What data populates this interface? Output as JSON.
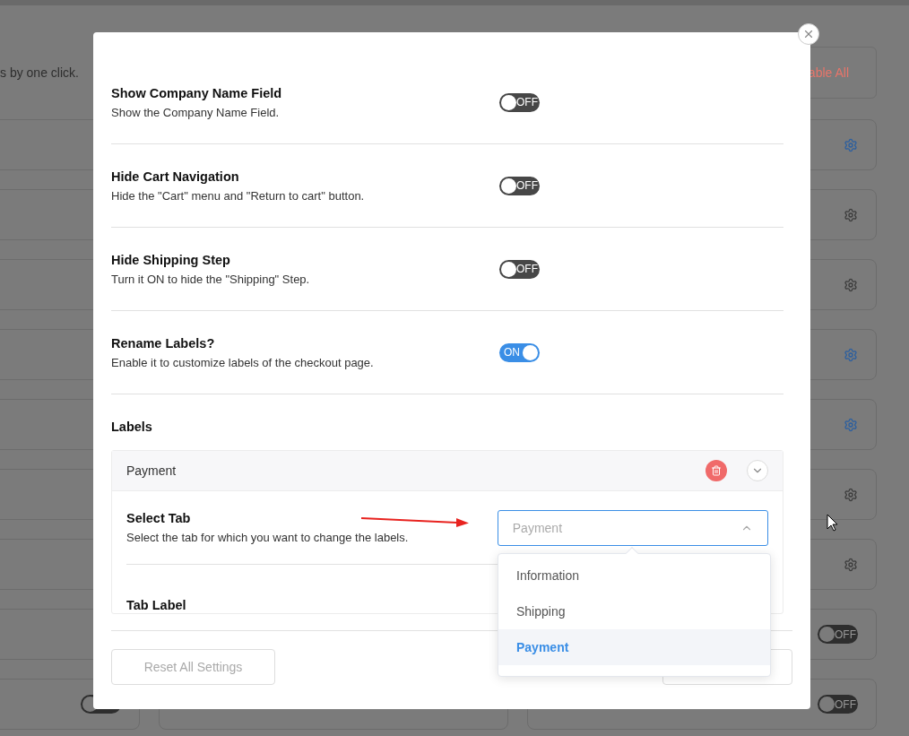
{
  "background": {
    "subtitle": "s by one click.",
    "disable_button": "able All",
    "left_cards": [
      {
        "kind": "plain"
      },
      {
        "kind": "plain"
      },
      {
        "kind": "plain"
      },
      {
        "kind": "plain"
      },
      {
        "kind": "plain"
      },
      {
        "kind": "plain"
      },
      {
        "kind": "plain"
      },
      {
        "kind": "plain"
      },
      {
        "kind": "toggle",
        "on": false
      }
    ],
    "right_cards": [
      {
        "kind": "gear",
        "active": true
      },
      {
        "kind": "gear",
        "active": false
      },
      {
        "kind": "gear",
        "active": false
      },
      {
        "kind": "gear",
        "active": true
      },
      {
        "kind": "gear",
        "active": true
      },
      {
        "kind": "gear",
        "active": false
      },
      {
        "kind": "gear",
        "active": false
      },
      {
        "kind": "toggle",
        "on": false,
        "label": "OFF"
      },
      {
        "kind": "toggle",
        "on": false,
        "label": "OFF"
      }
    ]
  },
  "modal": {
    "settings": [
      {
        "title": "Show Company Name Field",
        "description": "Show the Company Name Field.",
        "on": false,
        "label": "OFF"
      },
      {
        "title": "Hide Cart Navigation",
        "description": "Hide the \"Cart\" menu and \"Return to cart\" button.",
        "on": false,
        "label": "OFF"
      },
      {
        "title": "Hide Shipping Step",
        "description": "Turn it ON to hide the \"Shipping\" Step.",
        "on": false,
        "label": "OFF"
      },
      {
        "title": "Rename Labels?",
        "description": "Enable it to customize labels of the checkout page.",
        "on": true,
        "label": "ON"
      }
    ],
    "labels_heading": "Labels",
    "accordion": {
      "title": "Payment",
      "expanded": true,
      "select_tab": {
        "title": "Select Tab",
        "description": "Select the tab for which you want to change the labels.",
        "value": "Payment",
        "open": true
      },
      "tab_label_title": "Tab Label"
    },
    "dropdown": [
      {
        "label": "Information",
        "selected": false
      },
      {
        "label": "Shipping",
        "selected": false
      },
      {
        "label": "Payment",
        "selected": true
      }
    ],
    "reset_button": "Reset All Settings"
  }
}
